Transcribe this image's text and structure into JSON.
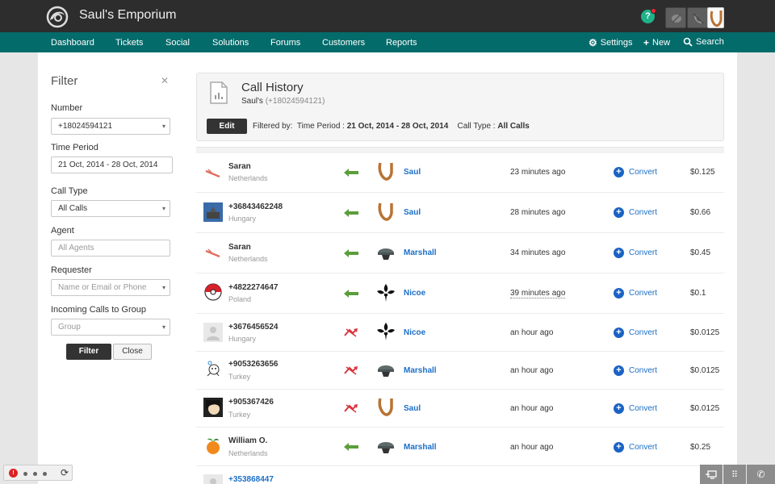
{
  "app": {
    "title": "Saul's Emporium"
  },
  "nav": {
    "items": [
      "Dashboard",
      "Tickets",
      "Social",
      "Solutions",
      "Forums",
      "Customers",
      "Reports"
    ],
    "settings": "Settings",
    "new": "New",
    "search": "Search"
  },
  "filter": {
    "title": "Filter",
    "number_label": "Number",
    "number_value": "+18024594121",
    "period_label": "Time Period",
    "period_value": "21 Oct, 2014 - 28 Oct, 2014",
    "calltype_label": "Call Type",
    "calltype_value": "All Calls",
    "agent_label": "Agent",
    "agent_placeholder": "All Agents",
    "requester_label": "Requester",
    "requester_placeholder": "Name or Email or Phone",
    "group_label": "Incoming Calls to Group",
    "group_placeholder": "Group",
    "filter_btn": "Filter",
    "close_btn": "Close"
  },
  "history": {
    "title": "Call History",
    "owner": "Saul's",
    "owner_number": "(+18024594121)",
    "edit_btn": "Edit",
    "filtered_by": "Filtered by:",
    "period_label": "Time Period :",
    "period_value": "21 Oct, 2014 - 28 Oct, 2014",
    "type_label": "Call Type :",
    "type_value": "All Calls"
  },
  "calls": [
    {
      "name": "Saran",
      "country": "Netherlands",
      "agent": "Saul",
      "time": "23 minutes ago",
      "convert": "Convert",
      "cost": "$0.125"
    },
    {
      "name": "+36843462248",
      "country": "Hungary",
      "agent": "Saul",
      "time": "28 minutes ago",
      "convert": "Convert",
      "cost": "$0.66"
    },
    {
      "name": "Saran",
      "country": "Netherlands",
      "agent": "Marshall",
      "time": "34 minutes ago",
      "convert": "Convert",
      "cost": "$0.45"
    },
    {
      "name": "+4822274647",
      "country": "Poland",
      "agent": "Nicoe",
      "time": "39 minutes ago",
      "convert": "Convert",
      "cost": "$0.1"
    },
    {
      "name": "+3676456524",
      "country": "Hungary",
      "agent": "Nicoe",
      "time": "an hour ago",
      "convert": "Convert",
      "cost": "$0.0125"
    },
    {
      "name": "+9053263656",
      "country": "Turkey",
      "agent": "Marshall",
      "time": "an hour ago",
      "convert": "Convert",
      "cost": "$0.0125"
    },
    {
      "name": "+905367426",
      "country": "Turkey",
      "agent": "Saul",
      "time": "an hour ago",
      "convert": "Convert",
      "cost": "$0.0125"
    },
    {
      "name": "William O.",
      "country": "Netherlands",
      "agent": "Marshall",
      "time": "an hour ago",
      "convert": "Convert",
      "cost": "$0.25"
    },
    {
      "name": "+353868447"
    }
  ],
  "icons": {
    "received_arrow": "arrow-left-icon",
    "missed_call": "missed-call-icon",
    "convert": "plus-circle-icon"
  },
  "colors": {
    "topbar": "#2d2d2d",
    "navbar": "#046b6b",
    "link": "#1c6fc6",
    "received": "#5a9e3a",
    "missed": "#d9363e"
  }
}
